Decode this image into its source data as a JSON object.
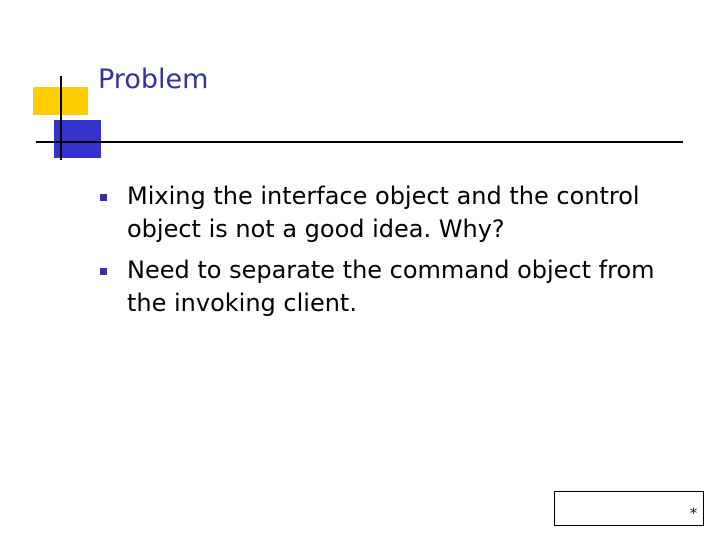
{
  "slide": {
    "title": "Problem",
    "bullets": [
      "Mixing the interface object and the control object is not a good idea. Why?",
      "Need to separate the command object from the invoking client."
    ],
    "page_number": "*"
  },
  "colors": {
    "title": "#333399",
    "bullet_marker": "#333399",
    "deco_yellow": "#ffcc00",
    "deco_blue": "#3333cc"
  }
}
